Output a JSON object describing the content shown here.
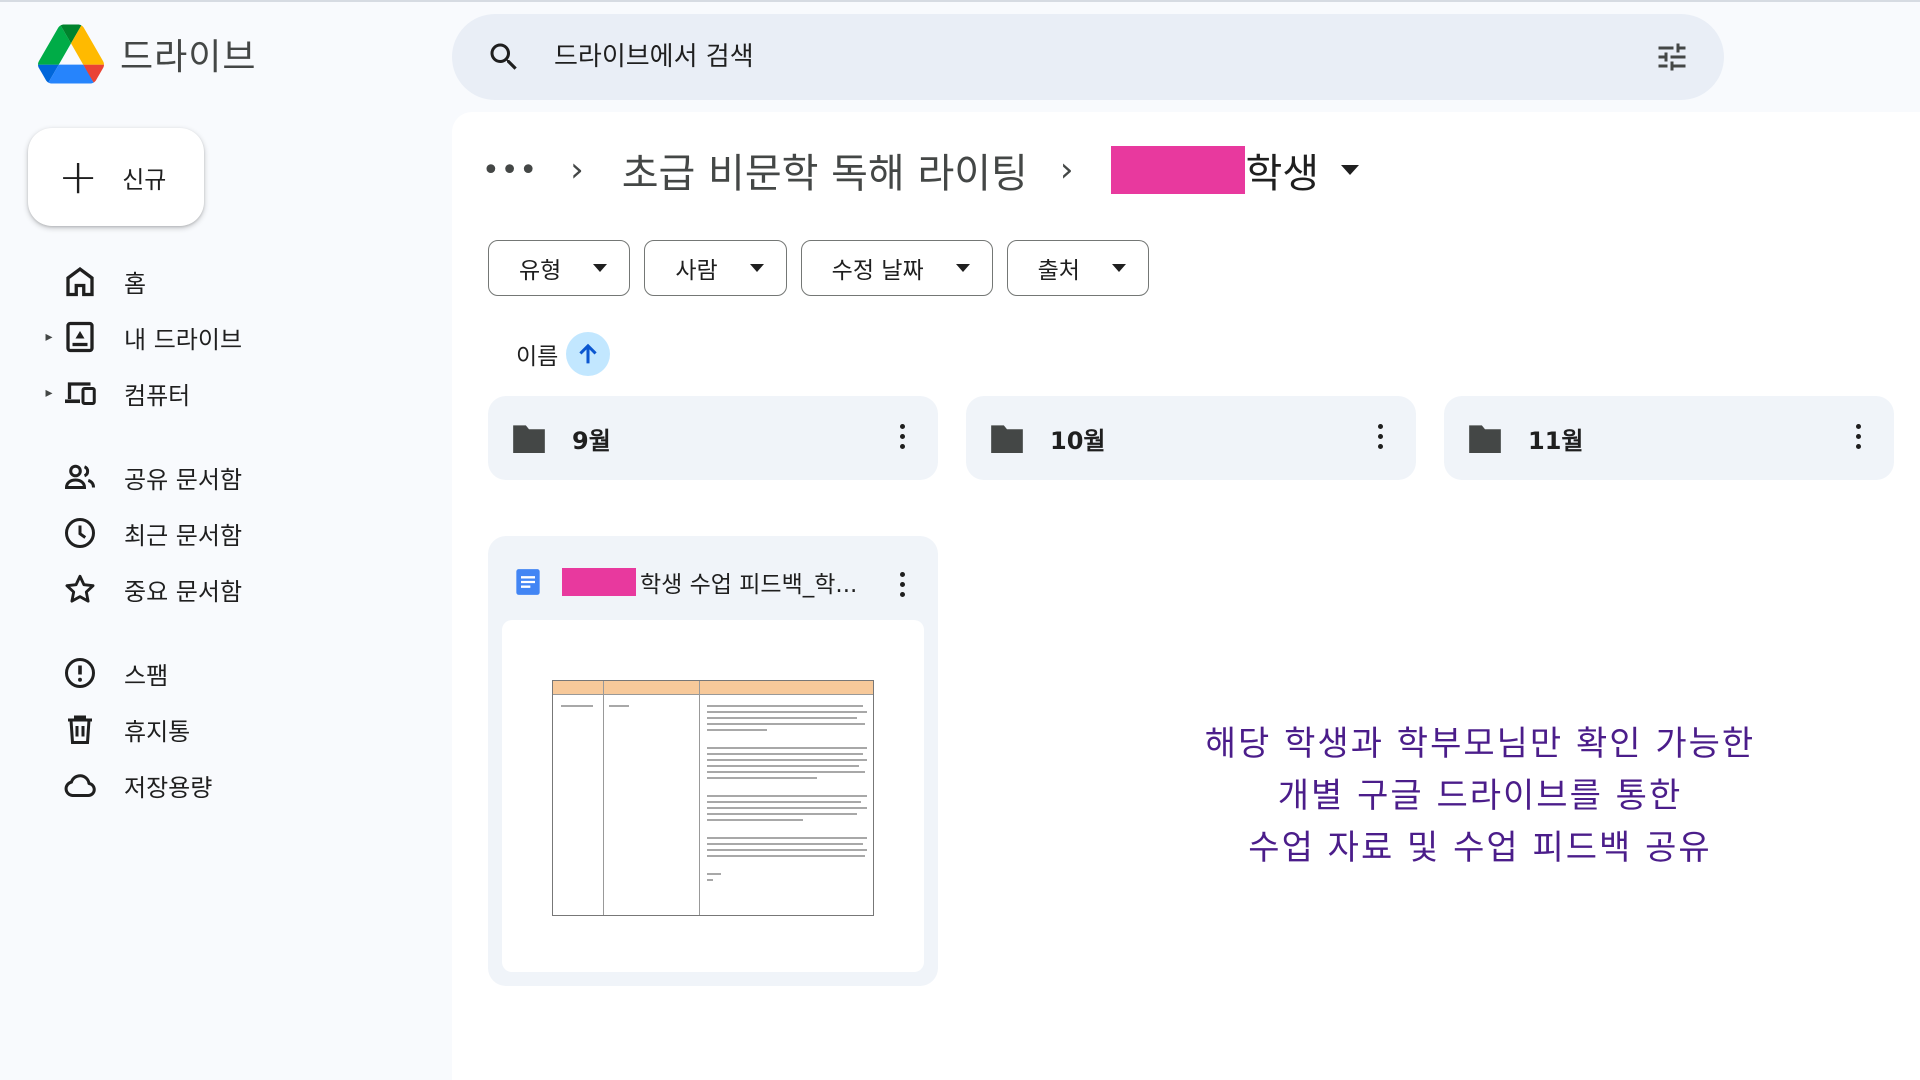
{
  "app": {
    "title": "드라이브",
    "new_label": "신규"
  },
  "search": {
    "placeholder": "드라이브에서 검색"
  },
  "sidebar": {
    "items": [
      {
        "label": "홈",
        "icon": "home-icon"
      },
      {
        "label": "내 드라이브",
        "icon": "my-drive-icon"
      },
      {
        "label": "컴퓨터",
        "icon": "computer-icon"
      },
      {
        "label": "공유 문서함",
        "icon": "shared-icon"
      },
      {
        "label": "최근 문서함",
        "icon": "clock-icon"
      },
      {
        "label": "중요 문서함",
        "icon": "star-icon"
      },
      {
        "label": "스팸",
        "icon": "spam-icon"
      },
      {
        "label": "휴지통",
        "icon": "trash-icon"
      },
      {
        "label": "저장용량",
        "icon": "cloud-icon"
      }
    ]
  },
  "breadcrumb": {
    "more": "•••",
    "parent": "초급 비문학 독해 라이팅",
    "current_suffix": "학생"
  },
  "filters": [
    "유형",
    "사람",
    "수정 날짜",
    "출처"
  ],
  "sort": {
    "label": "이름",
    "direction": "ascending"
  },
  "folders": [
    {
      "name": "9월"
    },
    {
      "name": "10월"
    },
    {
      "name": "11월"
    }
  ],
  "files": [
    {
      "name_suffix": "학생 수업 피드백_학...",
      "type": "google-docs"
    }
  ],
  "annotation": {
    "lines": [
      "해당 학생과 학부모님만 확인 가능한",
      "개별 구글 드라이브를 통한",
      "수업 자료 및 수업 피드백 공유"
    ],
    "color": "#4b1d8a"
  },
  "colors": {
    "redaction": "#e8399e",
    "search_bg": "#e9eef6",
    "card_bg": "#f0f4f9",
    "sort_accent": "#c2e7ff",
    "doc_blue": "#4285f4"
  }
}
